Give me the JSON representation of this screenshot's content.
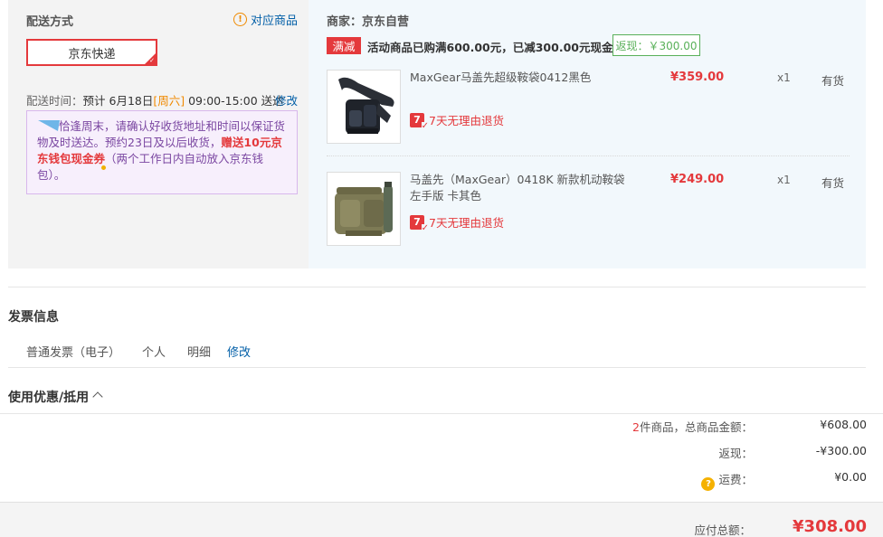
{
  "shipping": {
    "title": "配送方式",
    "match_link": "对应商品",
    "option": "京东快递",
    "time_label": "配送时间：",
    "time_prefix": "预计 6月18日",
    "time_weekday": "[周六]",
    "time_range": " 09:00-15:00 送达",
    "modify": "修改",
    "notice_text_1": "恰逢周末，请确认好收货地址和时间以保证货物及时送达。预约23日及以后收货，",
    "notice_strong": "赠送10元京东钱包现金券",
    "notice_text_2": "（两个工作日内自动放入京东钱包）。"
  },
  "order": {
    "merchant": "商家：京东自营",
    "promo_badge": "满减",
    "promo_text": "活动商品已购满600.00元，已减300.00元现金",
    "rebate": "返现：￥300.00",
    "items": [
      {
        "name": "MaxGear马盖先超级鞍袋0412黑色",
        "price": "¥359.00",
        "qty": "x1",
        "stock": "有货",
        "return_policy": "7天无理由退货",
        "return_icon": "7"
      },
      {
        "name": "马盖先（MaxGear）0418K 新款机动鞍袋左手版 卡其色",
        "price": "¥249.00",
        "qty": "x1",
        "stock": "有货",
        "return_policy": "7天无理由退货",
        "return_icon": "7"
      }
    ]
  },
  "invoice": {
    "title": "发票信息",
    "type": "普通发票（电子）",
    "header": "个人",
    "content": "明细",
    "modify": "修改"
  },
  "coupons": {
    "title": "使用优惠/抵用"
  },
  "summary": {
    "item_count": "2",
    "total_label": "件商品，总商品金额：",
    "total_value": "¥608.00",
    "rebate_label": "返现：",
    "rebate_value": "-¥300.00",
    "freight_label": "运费：",
    "freight_value": "¥0.00",
    "payable_label": "应付总额：",
    "payable_value": "¥308.00"
  },
  "colors": {
    "accent": "#e4393c",
    "link": "#005ea7",
    "rebate_green": "#59b059"
  },
  "icons": [
    "warning-icon",
    "check-corner-icon",
    "bird-icon",
    "return-7day-icon",
    "chevron-up-icon",
    "question-icon"
  ]
}
